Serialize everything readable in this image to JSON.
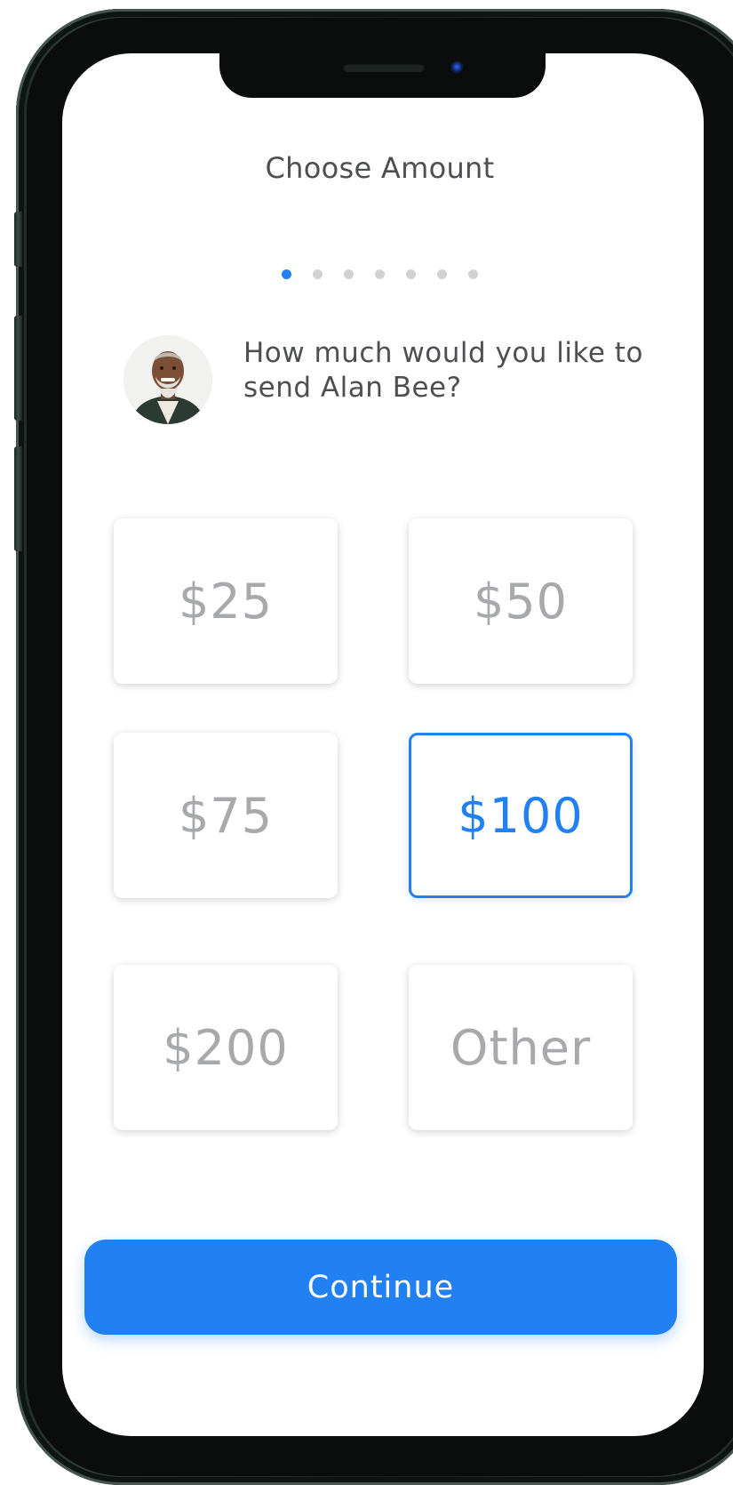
{
  "screen": {
    "title": "Choose Amount",
    "progress": {
      "total_steps": 7,
      "current_step": 1
    },
    "recipient": {
      "name": "Alan Bee",
      "prompt": "How much would you like to send Alan Bee?"
    },
    "amounts": [
      {
        "label": "$25",
        "selected": false
      },
      {
        "label": "$50",
        "selected": false
      },
      {
        "label": "$75",
        "selected": false
      },
      {
        "label": "$100",
        "selected": true
      },
      {
        "label": "$200",
        "selected": false
      },
      {
        "label": "Other",
        "selected": false
      }
    ],
    "continue_label": "Continue"
  },
  "colors": {
    "accent": "#2180f2",
    "text": "#4d4f53",
    "muted": "#a8a9ad",
    "dot_inactive": "#d2d2d2"
  }
}
